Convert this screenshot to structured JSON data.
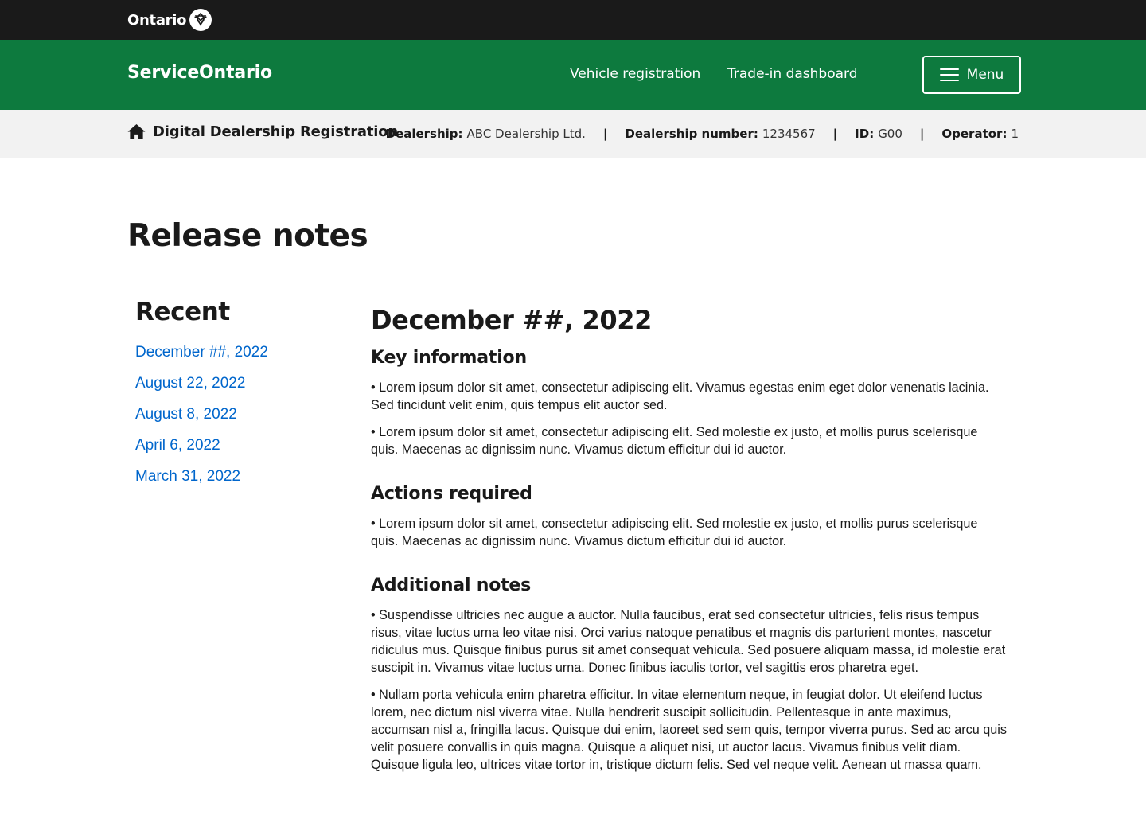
{
  "topbar": {
    "logo_text": "Ontario",
    "logo_icon": "trillium-icon"
  },
  "header": {
    "brand": "ServiceOntario",
    "nav": [
      {
        "label": "Vehicle registration"
      },
      {
        "label": "Trade-in dashboard"
      }
    ],
    "menu_label": "Menu"
  },
  "subbar": {
    "title": "Digital Dealership Registration",
    "home_icon": "home-icon",
    "meta": {
      "dealership_label": "Dealership:",
      "dealership_value": "ABC Dealership Ltd.",
      "dealership_number_label": "Dealership number:",
      "dealership_number_value": "1234567",
      "id_label": "ID:",
      "id_value": "G00",
      "operator_label": "Operator:",
      "operator_value": "1",
      "separator": "|"
    }
  },
  "page": {
    "title": "Release notes"
  },
  "sidebar": {
    "heading": "Recent",
    "items": [
      {
        "label": "December ##, 2022"
      },
      {
        "label": "August 22, 2022"
      },
      {
        "label": "August 8, 2022"
      },
      {
        "label": "April 6, 2022"
      },
      {
        "label": "March 31, 2022"
      }
    ]
  },
  "content": {
    "date_heading": "December ##, 2022",
    "sections": [
      {
        "heading": "Key information",
        "paragraphs": [
          "• Lorem ipsum dolor sit amet, consectetur adipiscing elit. Vivamus egestas enim eget dolor venenatis lacinia. Sed tincidunt velit enim, quis tempus elit auctor sed.",
          "• Lorem ipsum dolor sit amet, consectetur adipiscing elit. Sed molestie ex justo, et mollis purus scelerisque quis. Maecenas ac dignissim nunc. Vivamus dictum efficitur dui id auctor."
        ]
      },
      {
        "heading": "Actions required",
        "paragraphs": [
          "• Lorem ipsum dolor sit amet, consectetur adipiscing elit. Sed molestie ex justo, et mollis purus scelerisque quis. Maecenas ac dignissim nunc. Vivamus dictum efficitur dui id auctor."
        ]
      },
      {
        "heading": "Additional notes",
        "paragraphs": [
          "• Suspendisse ultricies nec augue a auctor. Nulla faucibus, erat sed consectetur ultricies, felis risus tempus risus, vitae luctus urna leo vitae nisi. Orci varius natoque penatibus et magnis dis parturient montes, nascetur ridiculus mus. Quisque finibus purus sit amet consequat vehicula. Sed posuere aliquam massa, id molestie erat suscipit in. Vivamus vitae luctus urna. Donec finibus iaculis tortor, vel sagittis eros pharetra eget.",
          "• Nullam porta vehicula enim pharetra efficitur. In vitae elementum neque, in feugiat dolor. Ut eleifend luctus lorem, nec dictum nisl viverra vitae. Nulla hendrerit suscipit sollicitudin. Pellentesque in ante maximus, accumsan nisl a, fringilla lacus. Quisque dui enim, laoreet sed sem quis, tempor viverra purus. Sed ac arcu quis velit posuere convallis in quis magna. Quisque a aliquet nisi, ut auctor lacus. Vivamus finibus velit diam. Quisque ligula leo, ultrices vitae tortor in, tristique dictum felis. Sed vel neque velit. Aenean ut massa quam."
        ]
      }
    ]
  },
  "colors": {
    "topbar_bg": "#1a1a1a",
    "header_green": "#0d7a3e",
    "subbar_bg": "#f2f2f2",
    "link_blue": "#0066cc"
  }
}
